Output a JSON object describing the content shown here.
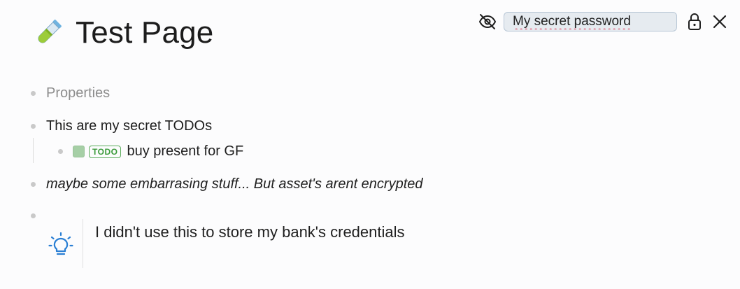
{
  "page": {
    "icon": "test-tube-icon",
    "title": "Test Page"
  },
  "toolbar": {
    "visibility_icon": "eye-off-icon",
    "password_value": "My secret password",
    "lock_icon": "lock-icon",
    "close_icon": "close-icon"
  },
  "blocks": {
    "properties_label": "Properties",
    "todos_heading": "This are my secret TODOs",
    "todo_item": {
      "marker": "TODO",
      "text": "buy present for GF"
    },
    "italic_note": "maybe some embarrasing stuff... But asset's arent encrypted",
    "callout": {
      "icon": "lightbulb-icon",
      "text": "I didn't use this to store my bank's credentials"
    }
  },
  "colors": {
    "background": "#fcfcfd",
    "todo_green": "#3b9b3b",
    "checkbox_green": "#a6cfa6",
    "callout_icon_blue": "#2a7fd4",
    "spellcheck_red": "#d24"
  }
}
